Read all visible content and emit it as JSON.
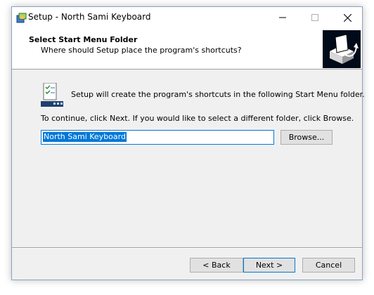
{
  "window": {
    "title": "Setup - North Sami Keyboard"
  },
  "header": {
    "title": "Select Start Menu Folder",
    "subtitle": "Where should Setup place the program's shortcuts?"
  },
  "body": {
    "intro": "Setup will create the program's shortcuts in the following Start Menu folder.",
    "instruction": "To continue, click Next. If you would like to select a different folder, click Browse.",
    "folder_value": "North Sami Keyboard",
    "browse_label": "Browse..."
  },
  "footer": {
    "back_label": "< Back",
    "next_label": "Next >",
    "cancel_label": "Cancel"
  },
  "icons": {
    "app": "setup-app-icon",
    "wizard": "installer-box-icon",
    "folder": "start-menu-folder-icon",
    "minimize": "minimize-icon",
    "maximize": "maximize-icon",
    "close": "close-icon"
  },
  "colors": {
    "accent": "#0078d7",
    "dialog_bg": "#f0f0f0",
    "header_bg": "#ffffff"
  }
}
